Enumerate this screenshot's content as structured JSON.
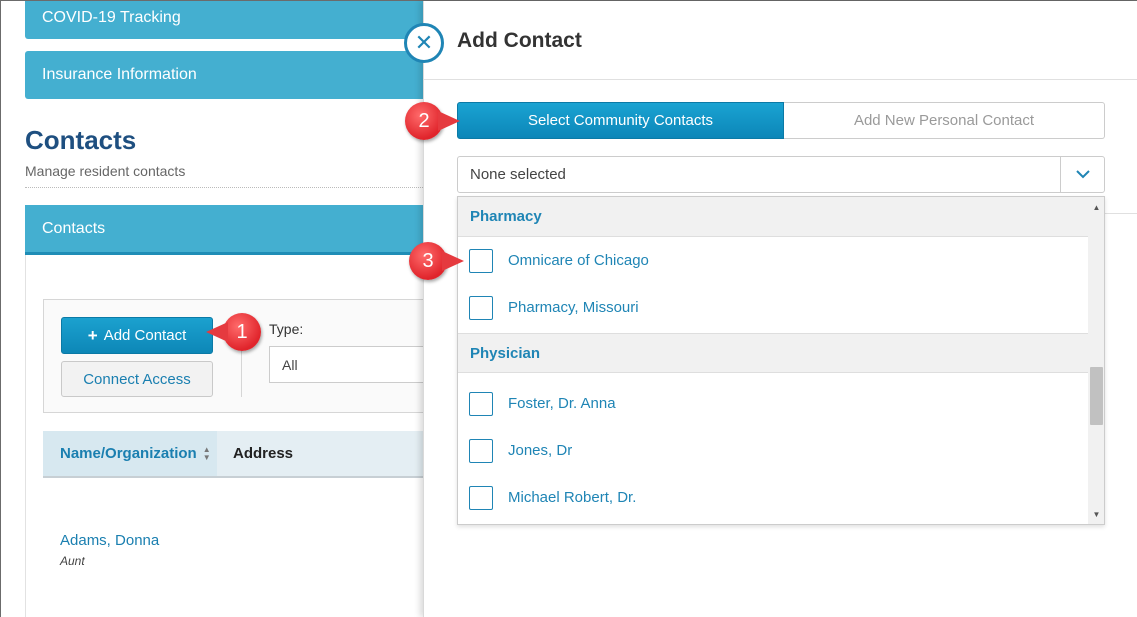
{
  "left_page": {
    "nav": {
      "covid_label": "COVID-19 Tracking",
      "insurance_label": "Insurance Information"
    },
    "section": {
      "title": "Contacts",
      "subtitle": "Manage resident contacts"
    },
    "contacts_panel_label": "Contacts",
    "toolbar": {
      "add_contact_label": "Add Contact",
      "connect_access_label": "Connect Access",
      "type_label": "Type:",
      "type_value": "All"
    },
    "table": {
      "columns": [
        "Name/Organization",
        "Address"
      ],
      "rows": [
        {
          "name": "Adams, Donna",
          "relation": "Aunt"
        }
      ]
    }
  },
  "modal": {
    "title": "Add Contact",
    "tabs": [
      {
        "label": "Select Community Contacts",
        "active": true
      },
      {
        "label": "Add New Personal Contact",
        "active": false
      }
    ],
    "select": {
      "value": "None selected"
    },
    "groups": [
      {
        "label": "Pharmacy",
        "options": [
          "Omnicare of Chicago",
          "Pharmacy, Missouri"
        ]
      },
      {
        "label": "Physician",
        "options": [
          "Foster, Dr. Anna",
          "Jones, Dr",
          "Michael Robert, Dr."
        ]
      }
    ]
  },
  "callouts": [
    "1",
    "2",
    "3"
  ],
  "colors": {
    "accent": "#1f85b5",
    "panel": "#44afd0",
    "callout": "#e0242b"
  }
}
